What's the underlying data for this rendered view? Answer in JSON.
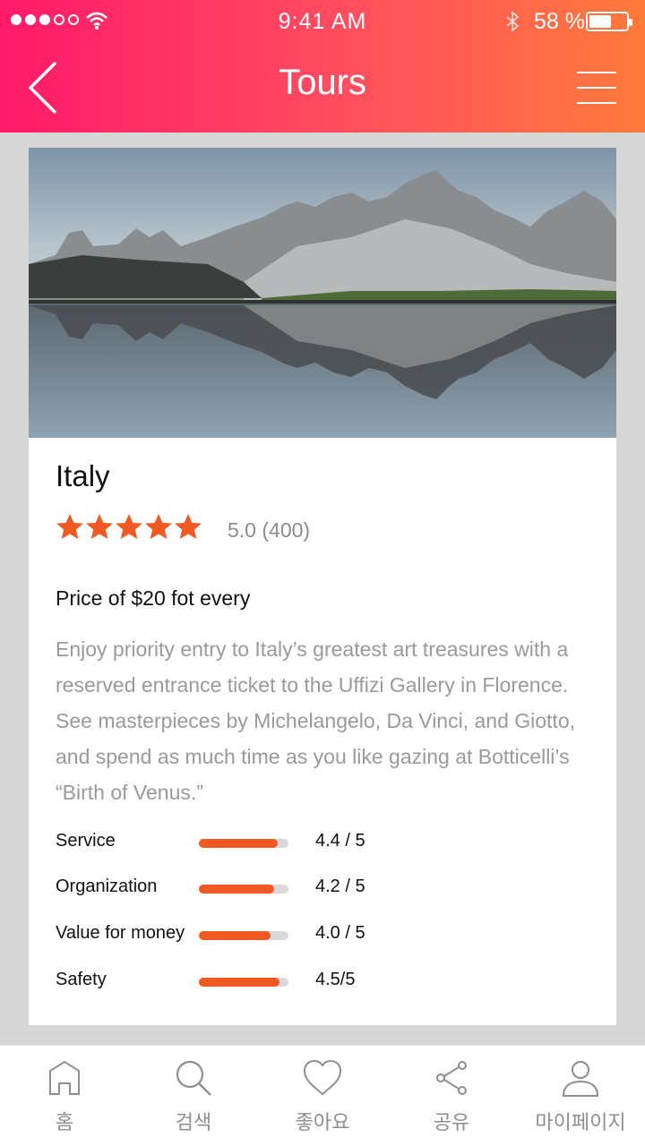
{
  "status_bar": {
    "time": "9:41 AM",
    "battery_text": "58 %",
    "battery_level": 0.58,
    "signal_bars_filled": 3,
    "signal_bars_total": 5
  },
  "header": {
    "title": "Tours",
    "back_icon": "chevron-left-icon",
    "menu_icon": "hamburger-menu-icon"
  },
  "tour": {
    "title": "Italy",
    "stars": 5,
    "rating_text": "5.0 (400)",
    "price": "Price of $20 fot every",
    "description": "Enjoy priority entry to Italy’s greatest art treasures with a reserved entrance ticket to the Uffizi Gallery in Florence. See masterpieces by Michelangelo, Da Vinci, and Giotto, and spend as much time as you like gazing at Botticelli’s “Birth of Venus.”",
    "metrics": [
      {
        "label": "Service",
        "score_text": "4.4 / 5",
        "value": 4.4,
        "max": 5
      },
      {
        "label": "Organization",
        "score_text": "4.2 / 5",
        "value": 4.2,
        "max": 5
      },
      {
        "label": "Value for money",
        "score_text": "4.0 / 5",
        "value": 4.0,
        "max": 5
      },
      {
        "label": "Safety",
        "score_text": "4.5/5",
        "value": 4.5,
        "max": 5
      }
    ]
  },
  "tabs": [
    {
      "label": "홈",
      "icon": "home-icon"
    },
    {
      "label": "검색",
      "icon": "search-icon"
    },
    {
      "label": "좋아요",
      "icon": "heart-icon"
    },
    {
      "label": "공유",
      "icon": "share-icon"
    },
    {
      "label": "마이페이지",
      "icon": "user-icon"
    }
  ],
  "colors": {
    "header_gradient_start": "#ff1a6a",
    "header_gradient_end": "#ff7a3a",
    "accent": "#f05a22",
    "track": "#d9d9d9",
    "muted_text": "#9a9a9a"
  }
}
